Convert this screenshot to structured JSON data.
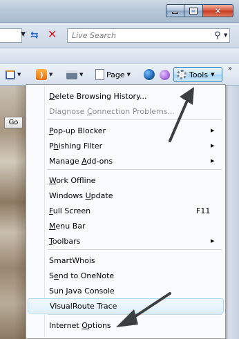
{
  "window": {
    "close_glyph": "✕"
  },
  "address_bar": {
    "search_placeholder": "Live Search"
  },
  "command_bar": {
    "page_label": "Page",
    "tools_label": "Tools",
    "more_glyph": "»"
  },
  "content": {
    "go_button_label": "Go"
  },
  "menu": {
    "items": [
      {
        "pre": "",
        "key": "D",
        "post": "elete Browsing History...",
        "shortcut": "",
        "submenu": false,
        "enabled": true
      },
      {
        "pre": "Diagnose ",
        "key": "C",
        "post": "onnection Problems...",
        "shortcut": "",
        "submenu": false,
        "enabled": false
      },
      {
        "pre": "",
        "key": "P",
        "post": "op-up Blocker",
        "shortcut": "",
        "submenu": true,
        "enabled": true
      },
      {
        "pre": "P",
        "key": "h",
        "post": "ishing Filter",
        "shortcut": "",
        "submenu": true,
        "enabled": true
      },
      {
        "pre": "Manage ",
        "key": "A",
        "post": "dd-ons",
        "shortcut": "",
        "submenu": true,
        "enabled": true
      },
      {
        "pre": "",
        "key": "W",
        "post": "ork Offline",
        "shortcut": "",
        "submenu": false,
        "enabled": true
      },
      {
        "pre": "Windows ",
        "key": "U",
        "post": "pdate",
        "shortcut": "",
        "submenu": false,
        "enabled": true
      },
      {
        "pre": "",
        "key": "F",
        "post": "ull Screen",
        "shortcut": "F11",
        "submenu": false,
        "enabled": true
      },
      {
        "pre": "",
        "key": "M",
        "post": "enu Bar",
        "shortcut": "",
        "submenu": false,
        "enabled": true
      },
      {
        "pre": "",
        "key": "T",
        "post": "oolbars",
        "shortcut": "",
        "submenu": true,
        "enabled": true
      },
      {
        "pre": "",
        "key": "",
        "post": "SmartWhois",
        "shortcut": "",
        "submenu": false,
        "enabled": true
      },
      {
        "pre": "S",
        "key": "e",
        "post": "nd to OneNote",
        "shortcut": "",
        "submenu": false,
        "enabled": true
      },
      {
        "pre": "",
        "key": "",
        "post": "Sun Java Console",
        "shortcut": "",
        "submenu": false,
        "enabled": true
      },
      {
        "pre": "",
        "key": "",
        "post": "VisualRoute Trace",
        "shortcut": "",
        "submenu": false,
        "enabled": true,
        "highlighted": true
      },
      {
        "pre": "Internet ",
        "key": "O",
        "post": "ptions",
        "shortcut": "",
        "submenu": false,
        "enabled": true
      }
    ]
  },
  "colors": {
    "arrow": "#3b3f3f",
    "highlight_border": "#a8d8f3"
  }
}
